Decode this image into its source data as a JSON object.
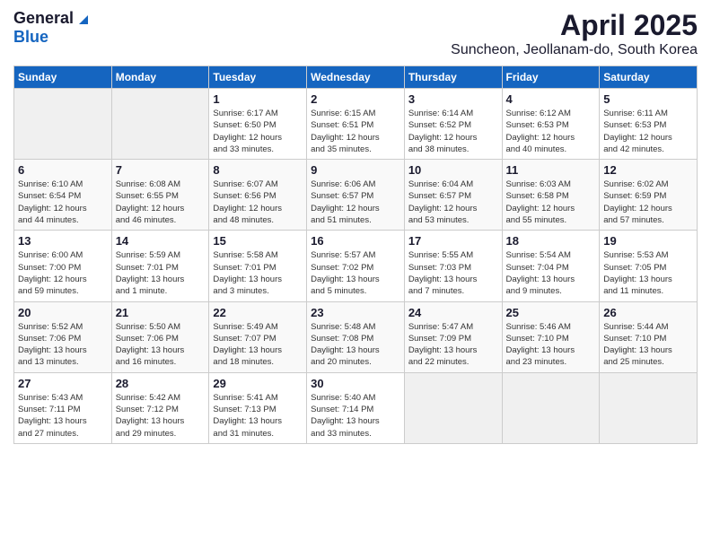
{
  "logo": {
    "general": "General",
    "blue": "Blue"
  },
  "title": "April 2025",
  "location": "Suncheon, Jeollanam-do, South Korea",
  "days_of_week": [
    "Sunday",
    "Monday",
    "Tuesday",
    "Wednesday",
    "Thursday",
    "Friday",
    "Saturday"
  ],
  "weeks": [
    [
      {
        "day": "",
        "info": ""
      },
      {
        "day": "",
        "info": ""
      },
      {
        "day": "1",
        "info": "Sunrise: 6:17 AM\nSunset: 6:50 PM\nDaylight: 12 hours\nand 33 minutes."
      },
      {
        "day": "2",
        "info": "Sunrise: 6:15 AM\nSunset: 6:51 PM\nDaylight: 12 hours\nand 35 minutes."
      },
      {
        "day": "3",
        "info": "Sunrise: 6:14 AM\nSunset: 6:52 PM\nDaylight: 12 hours\nand 38 minutes."
      },
      {
        "day": "4",
        "info": "Sunrise: 6:12 AM\nSunset: 6:53 PM\nDaylight: 12 hours\nand 40 minutes."
      },
      {
        "day": "5",
        "info": "Sunrise: 6:11 AM\nSunset: 6:53 PM\nDaylight: 12 hours\nand 42 minutes."
      }
    ],
    [
      {
        "day": "6",
        "info": "Sunrise: 6:10 AM\nSunset: 6:54 PM\nDaylight: 12 hours\nand 44 minutes."
      },
      {
        "day": "7",
        "info": "Sunrise: 6:08 AM\nSunset: 6:55 PM\nDaylight: 12 hours\nand 46 minutes."
      },
      {
        "day": "8",
        "info": "Sunrise: 6:07 AM\nSunset: 6:56 PM\nDaylight: 12 hours\nand 48 minutes."
      },
      {
        "day": "9",
        "info": "Sunrise: 6:06 AM\nSunset: 6:57 PM\nDaylight: 12 hours\nand 51 minutes."
      },
      {
        "day": "10",
        "info": "Sunrise: 6:04 AM\nSunset: 6:57 PM\nDaylight: 12 hours\nand 53 minutes."
      },
      {
        "day": "11",
        "info": "Sunrise: 6:03 AM\nSunset: 6:58 PM\nDaylight: 12 hours\nand 55 minutes."
      },
      {
        "day": "12",
        "info": "Sunrise: 6:02 AM\nSunset: 6:59 PM\nDaylight: 12 hours\nand 57 minutes."
      }
    ],
    [
      {
        "day": "13",
        "info": "Sunrise: 6:00 AM\nSunset: 7:00 PM\nDaylight: 12 hours\nand 59 minutes."
      },
      {
        "day": "14",
        "info": "Sunrise: 5:59 AM\nSunset: 7:01 PM\nDaylight: 13 hours\nand 1 minute."
      },
      {
        "day": "15",
        "info": "Sunrise: 5:58 AM\nSunset: 7:01 PM\nDaylight: 13 hours\nand 3 minutes."
      },
      {
        "day": "16",
        "info": "Sunrise: 5:57 AM\nSunset: 7:02 PM\nDaylight: 13 hours\nand 5 minutes."
      },
      {
        "day": "17",
        "info": "Sunrise: 5:55 AM\nSunset: 7:03 PM\nDaylight: 13 hours\nand 7 minutes."
      },
      {
        "day": "18",
        "info": "Sunrise: 5:54 AM\nSunset: 7:04 PM\nDaylight: 13 hours\nand 9 minutes."
      },
      {
        "day": "19",
        "info": "Sunrise: 5:53 AM\nSunset: 7:05 PM\nDaylight: 13 hours\nand 11 minutes."
      }
    ],
    [
      {
        "day": "20",
        "info": "Sunrise: 5:52 AM\nSunset: 7:06 PM\nDaylight: 13 hours\nand 13 minutes."
      },
      {
        "day": "21",
        "info": "Sunrise: 5:50 AM\nSunset: 7:06 PM\nDaylight: 13 hours\nand 16 minutes."
      },
      {
        "day": "22",
        "info": "Sunrise: 5:49 AM\nSunset: 7:07 PM\nDaylight: 13 hours\nand 18 minutes."
      },
      {
        "day": "23",
        "info": "Sunrise: 5:48 AM\nSunset: 7:08 PM\nDaylight: 13 hours\nand 20 minutes."
      },
      {
        "day": "24",
        "info": "Sunrise: 5:47 AM\nSunset: 7:09 PM\nDaylight: 13 hours\nand 22 minutes."
      },
      {
        "day": "25",
        "info": "Sunrise: 5:46 AM\nSunset: 7:10 PM\nDaylight: 13 hours\nand 23 minutes."
      },
      {
        "day": "26",
        "info": "Sunrise: 5:44 AM\nSunset: 7:10 PM\nDaylight: 13 hours\nand 25 minutes."
      }
    ],
    [
      {
        "day": "27",
        "info": "Sunrise: 5:43 AM\nSunset: 7:11 PM\nDaylight: 13 hours\nand 27 minutes."
      },
      {
        "day": "28",
        "info": "Sunrise: 5:42 AM\nSunset: 7:12 PM\nDaylight: 13 hours\nand 29 minutes."
      },
      {
        "day": "29",
        "info": "Sunrise: 5:41 AM\nSunset: 7:13 PM\nDaylight: 13 hours\nand 31 minutes."
      },
      {
        "day": "30",
        "info": "Sunrise: 5:40 AM\nSunset: 7:14 PM\nDaylight: 13 hours\nand 33 minutes."
      },
      {
        "day": "",
        "info": ""
      },
      {
        "day": "",
        "info": ""
      },
      {
        "day": "",
        "info": ""
      }
    ]
  ]
}
